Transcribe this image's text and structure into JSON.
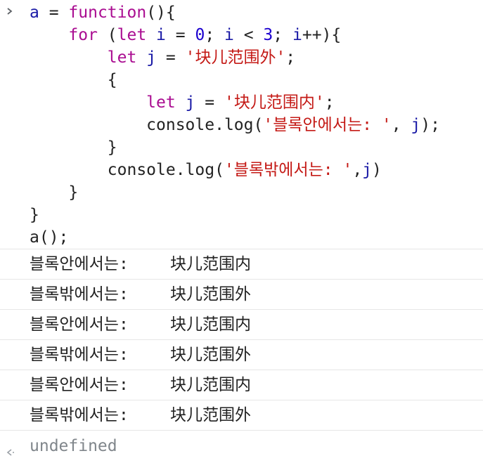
{
  "code": {
    "line1": {
      "a": "a",
      "eq": " = ",
      "fn": "function",
      "rest": "(){"
    },
    "line2": {
      "indent": "    ",
      "for": "for",
      "open": " (",
      "let": "let",
      "sp1": " ",
      "i1": "i",
      "eq": " = ",
      "zero": "0",
      "semi1": "; ",
      "i2": "i",
      "lt": " < ",
      "three": "3",
      "semi2": "; ",
      "i3": "i",
      "inc": "++){"
    },
    "line3": {
      "indent": "        ",
      "let": "let",
      "sp": " ",
      "j": "j",
      "eq": " = ",
      "str": "'块儿范围外'",
      "end": ";"
    },
    "line4": {
      "indent": "        ",
      "text": "{"
    },
    "line5": {
      "indent": "            ",
      "let": "let",
      "sp": " ",
      "j": "j",
      "eq": " = ",
      "str": "'块儿范围内'",
      "end": ";"
    },
    "line6": {
      "indent": "            ",
      "pre": "console.log(",
      "str": "'블록안에서는: '",
      "comma": ", ",
      "j": "j",
      "end": ");"
    },
    "line7": {
      "indent": "        ",
      "text": "}"
    },
    "line8": {
      "indent": "        ",
      "pre": "console.log(",
      "str": "'블록밖에서는: '",
      "comma": ",",
      "j": "j",
      "end": ")"
    },
    "line9": {
      "indent": "    ",
      "text": "}"
    },
    "line10": {
      "text": "}"
    },
    "line11": {
      "text": "a();"
    }
  },
  "logs": [
    {
      "label": "블록안에서는:",
      "value": "块儿范围内"
    },
    {
      "label": "블록밖에서는:",
      "value": "块儿范围外"
    },
    {
      "label": "블록안에서는:",
      "value": "块儿范围内"
    },
    {
      "label": "블록밖에서는:",
      "value": "块儿范围外"
    },
    {
      "label": "블록안에서는:",
      "value": "块儿范围内"
    },
    {
      "label": "블록밖에서는:",
      "value": "块儿范围外"
    }
  ],
  "result": {
    "text": "undefined"
  },
  "icons": {
    "prompt": "chevron-right-icon",
    "result": "return-arrow-icon"
  }
}
